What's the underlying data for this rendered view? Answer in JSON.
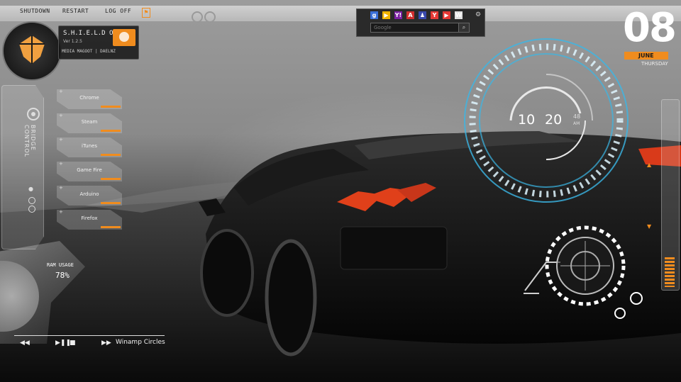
{
  "topbar": {
    "shutdown_label": "SHUTDOWN",
    "restart_label": "RESTART",
    "logoff_label": "LOG OFF"
  },
  "profile": {
    "os_name": "S.H.I.E.L.D OS",
    "version": "Ver 1.2.5",
    "credit": "MEDIA MAGOOT | DAELNZ"
  },
  "launchers": [
    {
      "label": "Chrome"
    },
    {
      "label": "Steam"
    },
    {
      "label": "iTunes"
    },
    {
      "label": "Game Fire"
    },
    {
      "label": "Arduino"
    },
    {
      "label": "Firefox"
    }
  ],
  "sidebar": {
    "title": "BRIDGE CONTROL"
  },
  "ram": {
    "label": "RAM USAGE",
    "value": "78%"
  },
  "player": {
    "title": "Winamp Circles"
  },
  "search": {
    "placeholder": "Google"
  },
  "search_icons": [
    {
      "name": "google-icon",
      "glyph": "g",
      "color": "#3a6fd8"
    },
    {
      "name": "play-icon",
      "glyph": "▶",
      "color": "#f0b400"
    },
    {
      "name": "yahoo-icon",
      "glyph": "Y!",
      "color": "#7b1fa2"
    },
    {
      "name": "adobe-icon",
      "glyph": "A",
      "color": "#d32f2f"
    },
    {
      "name": "people-icon",
      "glyph": "♟",
      "color": "#3949ab"
    },
    {
      "name": "y-icon",
      "glyph": "Y",
      "color": "#e53935"
    },
    {
      "name": "youtube-icon",
      "glyph": "▶",
      "color": "#e53935"
    },
    {
      "name": "wikipedia-icon",
      "glyph": "W",
      "color": "#e0e0e0"
    }
  ],
  "date": {
    "day": "08",
    "month": "JUNE",
    "weekday": "THURSDAY"
  },
  "clock": {
    "hour": "10",
    "minute": "20",
    "second": "48",
    "ampm": "AM"
  },
  "colors": {
    "accent": "#f08c1e",
    "ring": "#3bb7e6"
  }
}
